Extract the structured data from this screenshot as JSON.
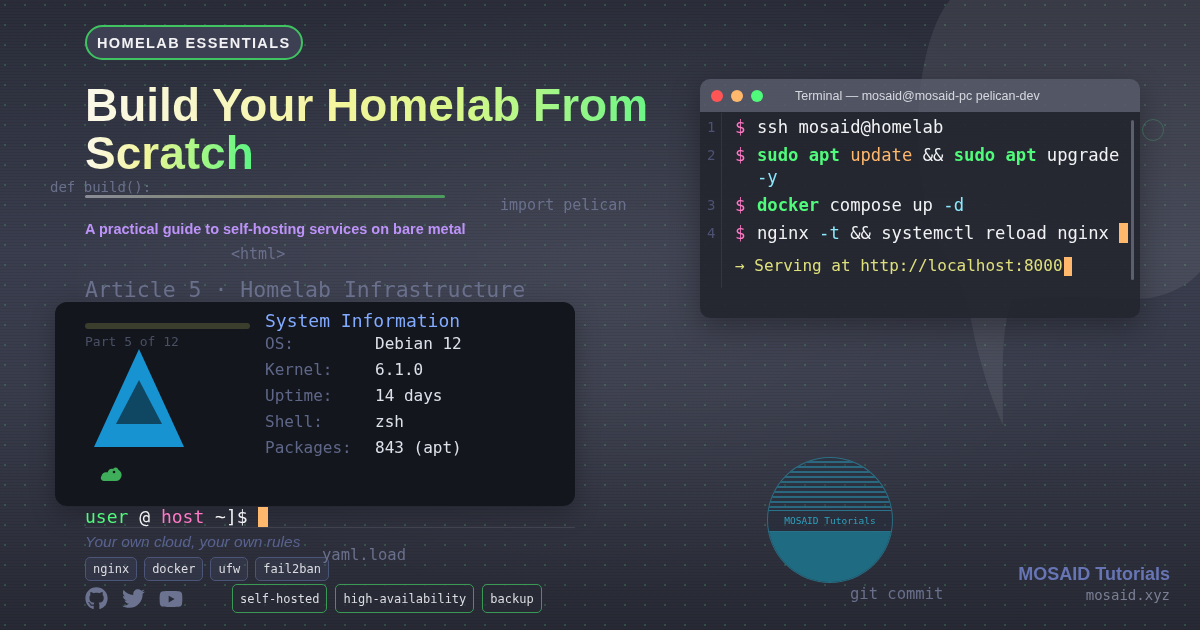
{
  "badge": {
    "label": "HOMELAB ESSENTIALS"
  },
  "title": "Build Your Homelab From Scratch",
  "subtitle": "A practical guide to self-hosting services on bare metal",
  "background_code": [
    {
      "text": "def build():"
    },
    {
      "text": "import pelican"
    },
    {
      "text": "<html>"
    },
    {
      "text": "Article 5 · Homelab Infrastructure"
    },
    {
      "text": "Part 5 of 12"
    },
    {
      "text": "yaml.load"
    },
    {
      "text": "git commit"
    }
  ],
  "system_info": {
    "title": "System Information",
    "rows": [
      {
        "label": "OS:",
        "value": "Debian 12"
      },
      {
        "label": "Kernel:",
        "value": "6.1.0"
      },
      {
        "label": "Uptime:",
        "value": "14 days"
      },
      {
        "label": "Shell:",
        "value": "zsh"
      },
      {
        "label": "Packages:",
        "value": "843 (apt)"
      }
    ]
  },
  "prompt": {
    "tokens": [
      {
        "text": "user",
        "kind": "user"
      },
      {
        "text": "@",
        "kind": "plain"
      },
      {
        "text": "host",
        "kind": "host"
      },
      {
        "text": "~]$",
        "kind": "plain"
      }
    ],
    "cursor": true
  },
  "tagline": "Your own cloud, your own rules",
  "tools": [
    {
      "label": "nginx"
    },
    {
      "label": "docker"
    },
    {
      "label": "ufw"
    },
    {
      "label": "fail2ban"
    }
  ],
  "topics": [
    {
      "label": "self-hosted"
    },
    {
      "label": "high-availability"
    },
    {
      "label": "backup"
    }
  ],
  "terminal": {
    "title": "Terminal — mosaid@mosaid-pc pelican-dev",
    "lines": [
      {
        "number": "1",
        "prompt": "$",
        "tokens": [
          {
            "text": "ssh mosaid@homelab",
            "kind": "plain"
          }
        ],
        "cursor": false
      },
      {
        "number": "2",
        "prompt": "$",
        "tokens": [
          {
            "text": "sudo",
            "kind": "command"
          },
          {
            "text": "apt",
            "kind": "command"
          },
          {
            "text": "update",
            "kind": "subcommand"
          },
          {
            "text": "&&",
            "kind": "plain"
          },
          {
            "text": "sudo",
            "kind": "command"
          },
          {
            "text": "apt",
            "kind": "command"
          },
          {
            "text": "upgrade",
            "kind": "plain"
          },
          {
            "text": "-y",
            "kind": "flag"
          }
        ],
        "cursor": false
      },
      {
        "number": "3",
        "prompt": "$",
        "tokens": [
          {
            "text": "docker",
            "kind": "command"
          },
          {
            "text": "compose up",
            "kind": "plain"
          },
          {
            "text": "-d",
            "kind": "flag"
          }
        ],
        "cursor": false
      },
      {
        "number": "4",
        "prompt": "$",
        "tokens": [
          {
            "text": "nginx",
            "kind": "plain"
          },
          {
            "text": "-t",
            "kind": "flag"
          },
          {
            "text": "&& systemctl reload nginx",
            "kind": "plain"
          }
        ],
        "cursor": true
      }
    ],
    "output": {
      "text": "→ Serving at http://localhost:8000",
      "cursor": true
    }
  },
  "logo": {
    "text": "MOSAID Tutorials"
  },
  "brand": {
    "name": "MOSAID Tutorials",
    "url": "mosaid.xyz"
  }
}
